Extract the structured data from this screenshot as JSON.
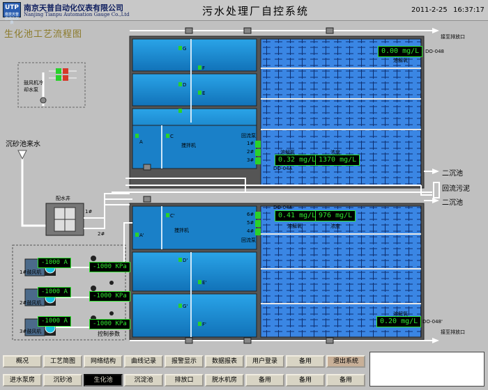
{
  "header": {
    "logo_text": "UTP",
    "logo_sub": "南京天普自动化仪表",
    "company_cn": "南京天普自动化仪表有限公司",
    "company_en": "Nanjing Tianpu Automation Gauge Co.,Ltd",
    "system_title": "污水处理厂自控系统",
    "date": "2011-2-25",
    "time": "16:37:17"
  },
  "page_title": "生化池工艺流程图",
  "labels": {
    "sand_water": "沉砂池来水",
    "blower_cooling": "鼓风机冷却水泵",
    "distribution_well": "配水井",
    "to_outlet": "接至排放口",
    "secondary_clarifier": "二沉池",
    "return_sludge": "回流污泥",
    "blower1": "1#鼓风机",
    "blower2": "2#鼓风机",
    "blower3": "3#鼓风机",
    "mixer": "搅拌机",
    "return_pump": "回流泵",
    "do_label": "溶解氧",
    "mlss_label": "浓度",
    "do_048": "DO-048",
    "do_04a": "DO-04A",
    "do_048b": "DO-048'",
    "pump1": "1#",
    "pump2": "2#",
    "pump3": "3#",
    "pump4": "4#",
    "pump5": "5#",
    "pump6": "6#",
    "mark_a": "A",
    "mark_b": "B",
    "mark_c": "C",
    "mark_d": "D",
    "mark_e": "E",
    "mark_f": "F",
    "mark_g": "G",
    "mark_ap": "A'",
    "mark_bp": "B'",
    "mark_cp": "C'",
    "mark_dp": "D'",
    "mark_ep": "E'",
    "mark_fp": "F'",
    "mark_gp": "G'",
    "ctrl_params": "控制参数"
  },
  "readouts": {
    "do_top": "0.00  mg/L",
    "do_mid1": "0.32  mg/L",
    "mlss_mid1": "1370  mg/L",
    "do_mid2": "0.41  mg/L",
    "mlss_mid2": "976  mg/L",
    "do_bottom": "0.20  mg/L",
    "blower1_current": "-1000 A",
    "blower1_pressure": "-1000 KPa",
    "blower2_current": "-1000 A",
    "blower2_pressure": "-1000 KPa",
    "blower3_current": "-1000 A",
    "blower3_pressure": "-1000 KPa"
  },
  "nav_row1": [
    "概况",
    "工艺简图",
    "网络结构",
    "曲线记录",
    "报警显示",
    "数据报表",
    "用户登录",
    "备用",
    "退出系统"
  ],
  "nav_row2": [
    "进水泵房",
    "沉砂池",
    "生化池",
    "沉淀池",
    "排放口",
    "脱水机房",
    "备用",
    "备用",
    "备用"
  ],
  "colors": {
    "tank_water": "#1e8fd0",
    "tank_wall": "#4a4a4a",
    "aeration": "#3a7fe0",
    "pipe": "#f4f4f4",
    "readout_text": "#2ee82e",
    "background": "#c0c0c0"
  }
}
